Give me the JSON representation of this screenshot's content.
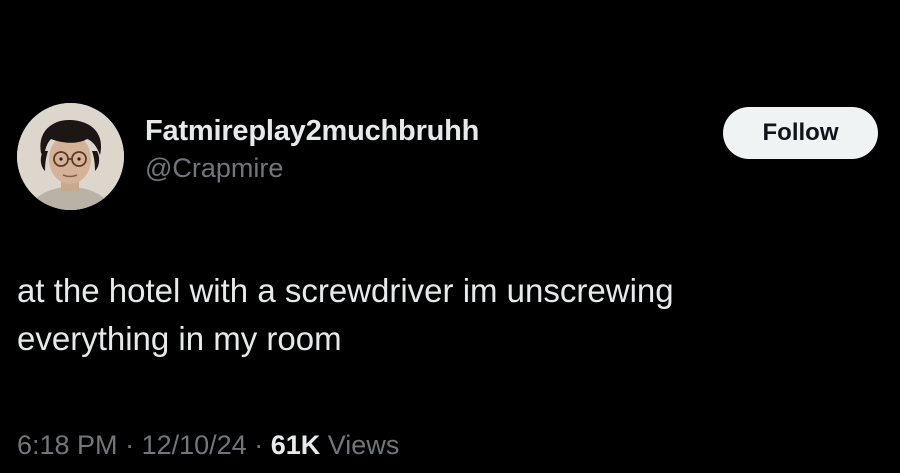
{
  "author": {
    "display_name": "Fatmireplay2muchbruhh",
    "handle": "@Crapmire",
    "avatar_icon": "profile-photo"
  },
  "follow_button": {
    "label": "Follow"
  },
  "tweet": {
    "text": "at the hotel with a screwdriver im unscrewing\neverything in my room"
  },
  "meta": {
    "time": "6:18 PM",
    "separator": "·",
    "date": "12/10/24",
    "views_count": "61K",
    "views_label": "Views"
  },
  "colors": {
    "background": "#000000",
    "primary_text": "#e7e9ea",
    "secondary_text": "#71767b",
    "follow_button_bg": "#eff3f4",
    "follow_button_text": "#0f1419"
  }
}
